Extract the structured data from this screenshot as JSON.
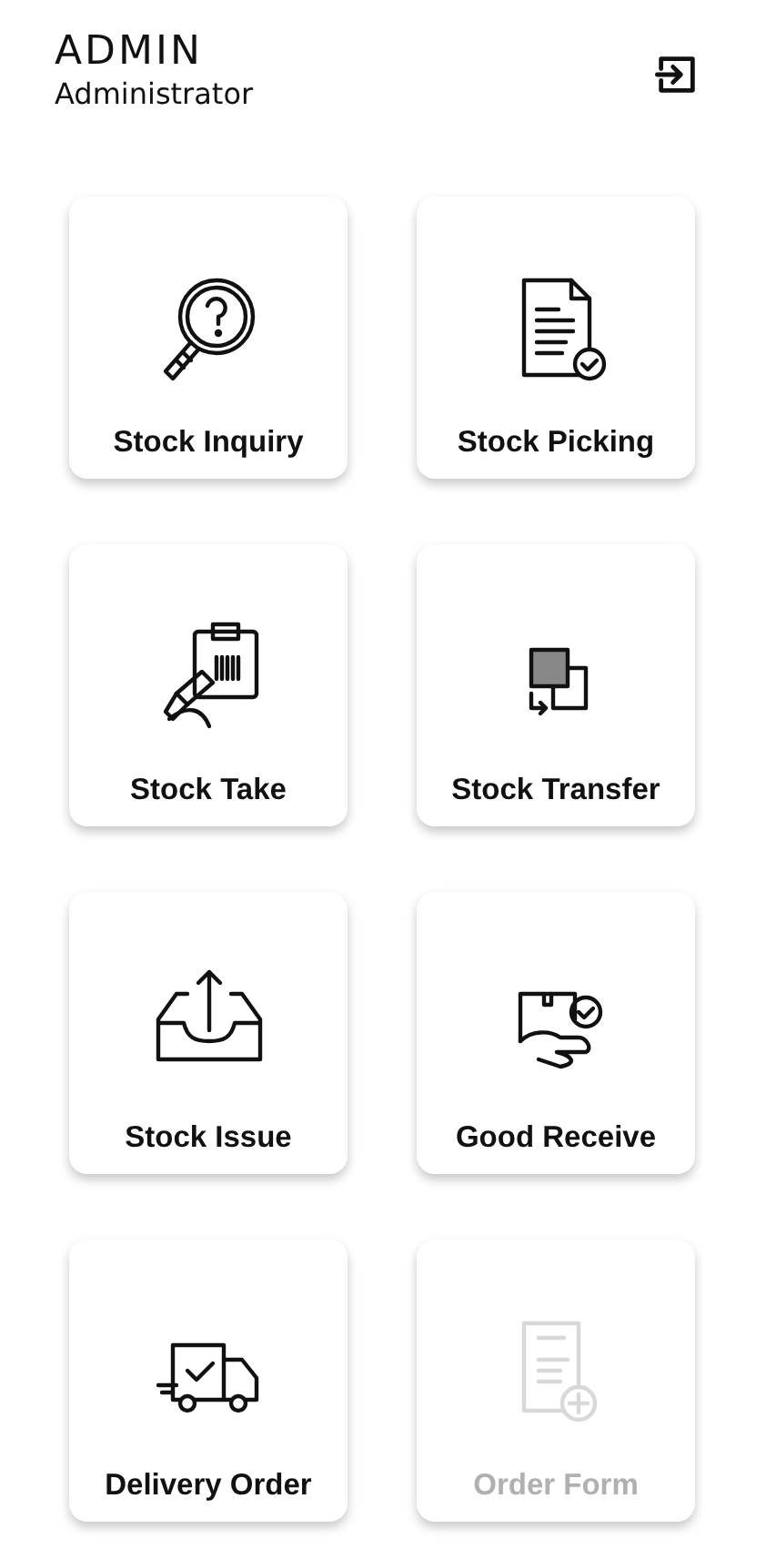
{
  "header": {
    "title": "ADMIN",
    "subtitle": "Administrator"
  },
  "menu": [
    {
      "label": "Stock Inquiry",
      "kind": "inquiry",
      "disabled": false
    },
    {
      "label": "Stock Picking",
      "kind": "picking",
      "disabled": false
    },
    {
      "label": "Stock Take",
      "kind": "take",
      "disabled": false
    },
    {
      "label": "Stock Transfer",
      "kind": "transfer",
      "disabled": false
    },
    {
      "label": "Stock Issue",
      "kind": "issue",
      "disabled": false
    },
    {
      "label": "Good Receive",
      "kind": "receive",
      "disabled": false
    },
    {
      "label": "Delivery Order",
      "kind": "delivery",
      "disabled": false
    },
    {
      "label": "Order Form",
      "kind": "form",
      "disabled": true
    }
  ]
}
